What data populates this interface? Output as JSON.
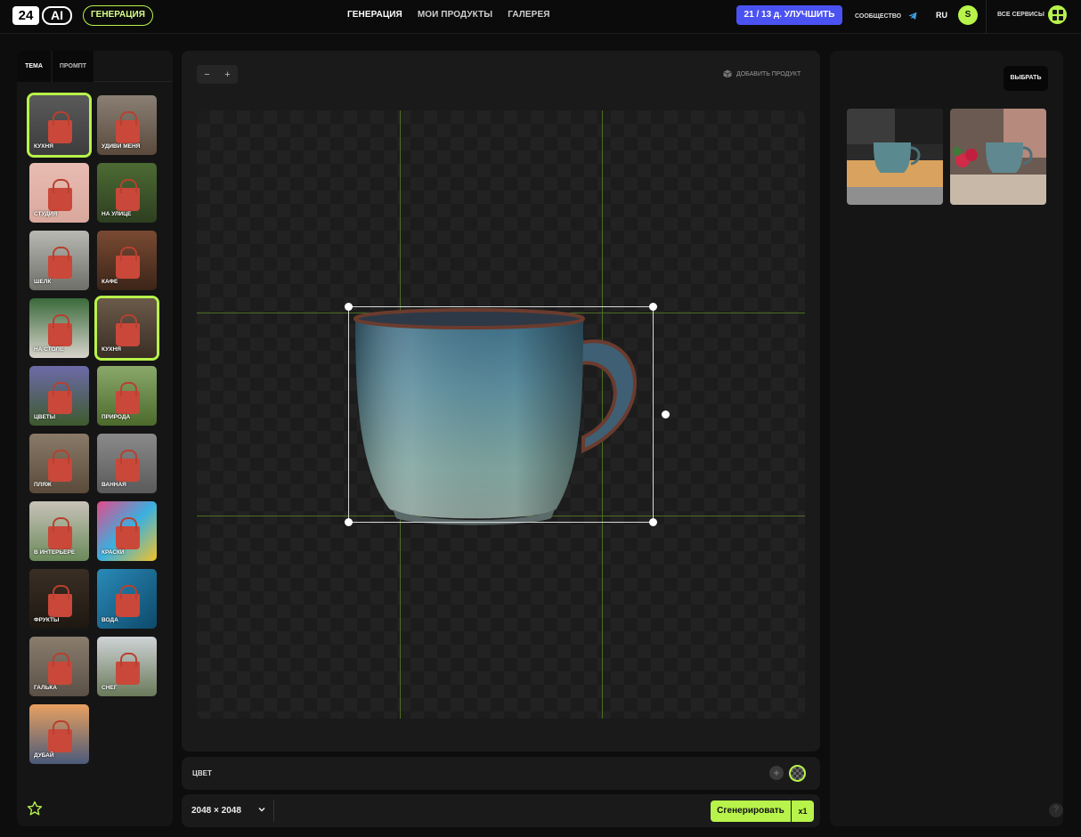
{
  "header": {
    "logo_num": "24",
    "logo_ai": "AI",
    "mode_pill": "ГЕНЕРАЦИЯ",
    "nav": [
      "ГЕНЕРАЦИЯ",
      "МОИ ПРОДУКТЫ",
      "ГАЛЕРЕЯ"
    ],
    "upgrade": "21 / 13 д. УЛУЧШИТЬ",
    "community": "СООБЩЕСТВО",
    "lang": "RU",
    "avatar": "S",
    "all_services": "ВСЕ СЕРВИСЫ"
  },
  "left_panel": {
    "tabs": [
      "ТЕМА",
      "ПРОМПТ"
    ],
    "themes": [
      {
        "label": "КУХНЯ",
        "selected": true
      },
      {
        "label": "УДИВИ МЕНЯ",
        "selected": false
      },
      {
        "label": "СТУДИЯ",
        "selected": false
      },
      {
        "label": "НА УЛИЦЕ",
        "selected": false
      },
      {
        "label": "ШЕЛК",
        "selected": false
      },
      {
        "label": "КАФЕ",
        "selected": false
      },
      {
        "label": "НА СТОЛЕ",
        "selected": false
      },
      {
        "label": "КУХНЯ",
        "selected": true
      },
      {
        "label": "ЦВЕТЫ",
        "selected": false
      },
      {
        "label": "ПРИРОДА",
        "selected": false
      },
      {
        "label": "ПЛЯЖ",
        "selected": false
      },
      {
        "label": "ВАННАЯ",
        "selected": false
      },
      {
        "label": "В ИНТЕРЬЕРЕ",
        "selected": false
      },
      {
        "label": "КРАСКИ",
        "selected": false
      },
      {
        "label": "ФРУКТЫ",
        "selected": false
      },
      {
        "label": "ВОДА",
        "selected": false
      },
      {
        "label": "ГАЛЬКА",
        "selected": false
      },
      {
        "label": "СНЕГ",
        "selected": false
      },
      {
        "label": "ДУБАЙ",
        "selected": false
      }
    ]
  },
  "canvas": {
    "zoom_out": "−",
    "zoom_in": "+",
    "add_product": "ДОБАВИТЬ ПРОДУКТ"
  },
  "color_bar": {
    "label": "ЦВЕТ"
  },
  "gen_bar": {
    "resolution": "2048 × 2048",
    "generate": "Сгенерировать",
    "multiplier": "x1"
  },
  "right_panel": {
    "choose": "ВЫБРАТЬ",
    "help": "?"
  },
  "colors": {
    "accent": "#b7f34a",
    "upgrade": "#4b52f2",
    "bag": "#c9483a"
  }
}
